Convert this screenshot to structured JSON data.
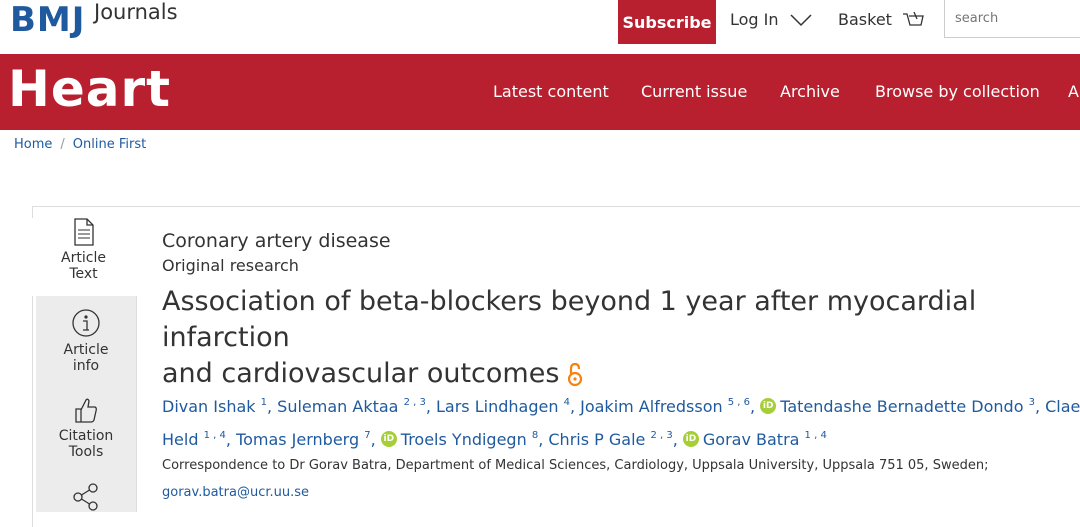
{
  "brand": {
    "bmj": "BMJ",
    "journals": "Journals"
  },
  "topbar": {
    "subscribe": "Subscribe",
    "login": "Log In",
    "basket": "Basket",
    "search_placeholder": "search"
  },
  "journal": {
    "title": "Heart"
  },
  "nav": [
    "Latest content",
    "Current issue",
    "Archive",
    "Browse by collection",
    "A"
  ],
  "breadcrumb": [
    "Home",
    "Online First"
  ],
  "sidebar": {
    "tabs": [
      {
        "label1": "Article",
        "label2": "Text",
        "icon": "document-icon"
      },
      {
        "label1": "Article",
        "label2": "info",
        "icon": "info-icon"
      },
      {
        "label1": "Citation",
        "label2": "Tools",
        "icon": "thumbs-up-icon"
      },
      {
        "label1": "",
        "label2": "",
        "icon": "share-icon"
      }
    ]
  },
  "article": {
    "subject": "Coronary artery disease",
    "type": "Original research",
    "title_line1": "Association of beta-blockers beyond 1 year after myocardial infarction",
    "title_line2": "and cardiovascular outcomes",
    "authors": [
      {
        "name": "Divan Ishak",
        "aff": "1",
        "orcid": false
      },
      {
        "name": "Suleman Aktaa",
        "aff": "2 , 3",
        "orcid": false
      },
      {
        "name": "Lars Lindhagen",
        "aff": "4",
        "orcid": false
      },
      {
        "name": "Joakim Alfredsson",
        "aff": "5 , 6",
        "orcid": false
      },
      {
        "name": "Tatendashe Bernadette Dondo",
        "aff": "3",
        "orcid": true
      },
      {
        "name": "Claes Held",
        "aff": "1 , 4",
        "orcid": false
      },
      {
        "name": "Tomas Jernberg",
        "aff": "7",
        "orcid": false
      },
      {
        "name": "Troels Yndigegn",
        "aff": "8",
        "orcid": true
      },
      {
        "name": "Chris P Gale",
        "aff": "2 , 3",
        "orcid": false
      },
      {
        "name": "Gorav Batra",
        "aff": "1 , 4",
        "orcid": true
      }
    ],
    "correspondence": "Correspondence to Dr Gorav Batra, Department of Medical Sciences, Cardiology, Uppsala University, Uppsala 751 05, Sweden;",
    "email": "gorav.batra@ucr.uu.se"
  },
  "colors": {
    "brand_blue": "#1f5a9e",
    "brand_red": "#b8202f",
    "orcid_green": "#a6ce39",
    "oa_orange": "#f68212"
  }
}
